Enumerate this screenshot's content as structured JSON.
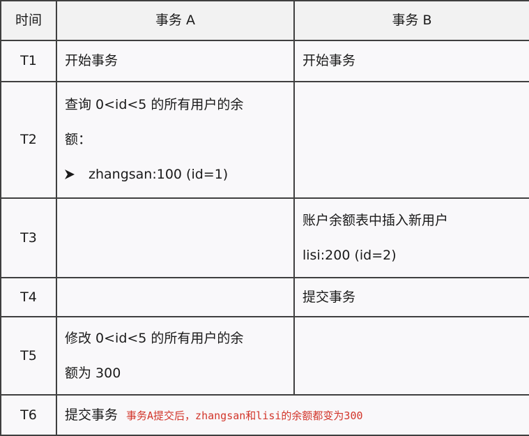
{
  "table": {
    "headers": [
      "时间",
      "事务 A",
      "事务 B"
    ],
    "rows": [
      {
        "time": "T1",
        "a": {
          "line1": "开始事务"
        },
        "b": {
          "line1": "开始事务"
        }
      },
      {
        "time": "T2",
        "a": {
          "line1": "查询 0<id<5 的所有用户的余",
          "line2": "额：",
          "bullet": "zhangsan:100 (id=1)"
        },
        "b": {}
      },
      {
        "time": "T3",
        "a": {},
        "b": {
          "line1": "账户余额表中插入新用户",
          "line2": "lisi:200 (id=2)"
        }
      },
      {
        "time": "T4",
        "a": {},
        "b": {
          "line1": "提交事务"
        }
      },
      {
        "time": "T5",
        "a": {
          "line1": "修改 0<id<5 的所有用户的余",
          "line2": "额为 300"
        },
        "b": {}
      },
      {
        "time": "T6",
        "a": {
          "line1": "提交事务",
          "note": "事务A提交后，zhangsan和lisi的余额都变为300"
        },
        "b": {}
      }
    ]
  },
  "colors": {
    "border": "#3f3f3f",
    "header_bg": "#f2f2f2",
    "cell_bg": "#f9f8fa",
    "note": "#d2352a"
  },
  "icons": {
    "bullet": "arrow-bullet-icon"
  }
}
